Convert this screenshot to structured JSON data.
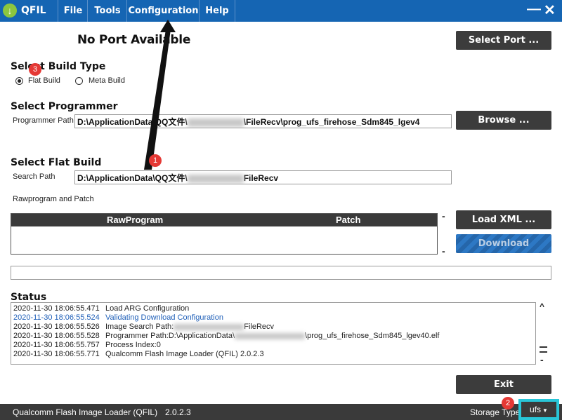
{
  "app": {
    "name": "QFIL",
    "logo_icon": "download-arrow-icon"
  },
  "menu": {
    "file": "File",
    "tools": "Tools",
    "configuration": "Configuration",
    "help": "Help"
  },
  "window": {
    "minimize": "—",
    "close": "✕"
  },
  "port": {
    "status": "No Port Available",
    "select_button": "Select Port ..."
  },
  "build_type": {
    "heading": "Select Build Type",
    "flat": "Flat Build",
    "meta": "Meta Build",
    "selected": "flat"
  },
  "programmer": {
    "heading": "Select Programmer",
    "label": "Programmer Path",
    "value_prefix": "D:\\ApplicationData\\QQ文件\\",
    "value_suffix": "\\FileRecv\\prog_ufs_firehose_Sdm845_lgev4",
    "browse_button": "Browse ..."
  },
  "flat_build": {
    "heading": "Select Flat Build",
    "label": "Search Path",
    "value_prefix": "D:\\ApplicationData\\QQ文件\\",
    "value_suffix": "FileRecv",
    "section_label": "Rawprogram and Patch",
    "col_rawprogram": "RawProgram",
    "col_patch": "Patch",
    "load_xml_button": "Load XML ...",
    "download_button": "Download"
  },
  "status": {
    "heading": "Status",
    "rows": [
      {
        "time": "2020-11-30 18:06:55.471",
        "message": "Load ARG Configuration",
        "color": "#222222"
      },
      {
        "time": "2020-11-30 18:06:55.524",
        "message": "Validating Download Configuration",
        "color": "#1f5fb8"
      },
      {
        "time": "2020-11-30 18:06:55.526",
        "message": "Image Search Path:",
        "message_suffix": "FileRecv",
        "color": "#222222"
      },
      {
        "time": "2020-11-30 18:06:55.528",
        "message": "Programmer Path:D:\\ApplicationData\\",
        "message_suffix": "\\prog_ufs_firehose_Sdm845_lgev40.elf",
        "color": "#222222"
      },
      {
        "time": "2020-11-30 18:06:55.757",
        "message": "Process Index:0",
        "color": "#222222"
      },
      {
        "time": "2020-11-30 18:06:55.771",
        "message": "Qualcomm Flash Image Loader (QFIL) 2.0.2.3",
        "color": "#222222"
      }
    ]
  },
  "exit_button": "Exit",
  "statusbar": {
    "product": "Qualcomm Flash Image Loader (QFIL)",
    "version": "2.0.2.3",
    "storage_label": "Storage Type:",
    "storage_value": "ufs"
  },
  "annotations": {
    "badge1": "1",
    "badge2": "2",
    "badge3": "3",
    "highlight_color": "#29c6d8",
    "badge_color": "#e53935"
  }
}
